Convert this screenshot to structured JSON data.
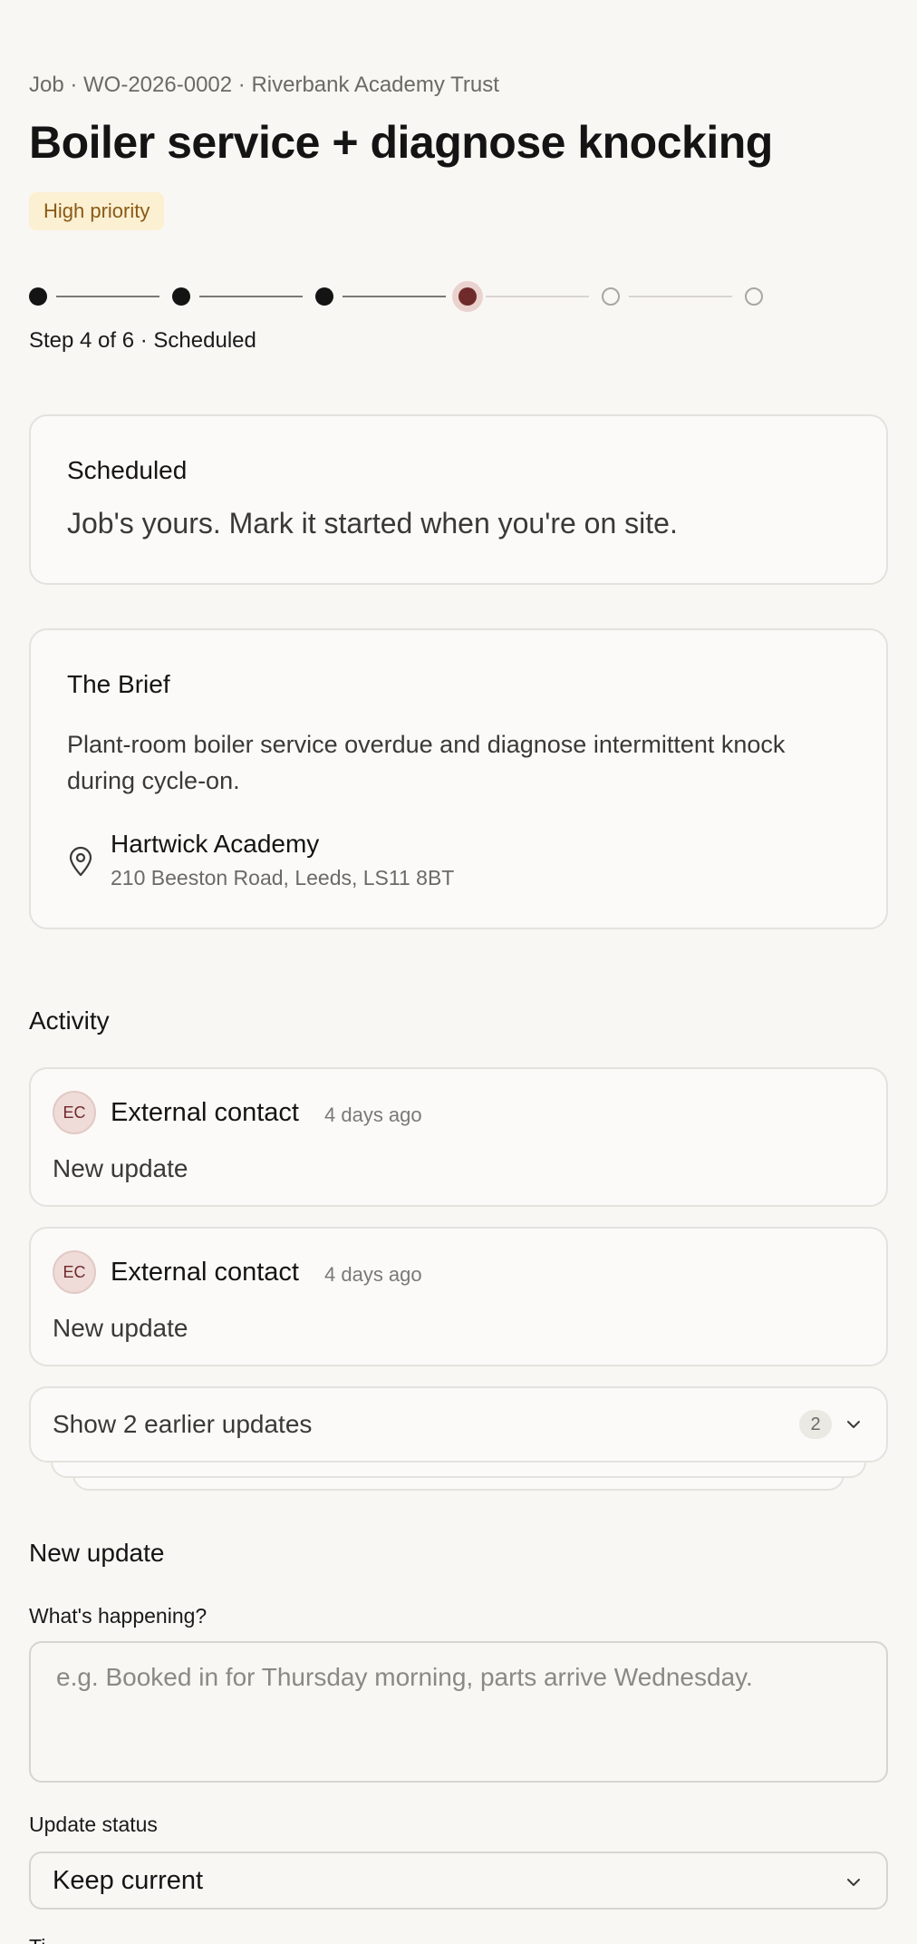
{
  "header": {
    "breadcrumb": "Job · WO-2026-0002 · Riverbank Academy Trust",
    "title": "Boiler service + diagnose knocking",
    "priority_badge": "High priority"
  },
  "progress": {
    "current_step": 4,
    "total_steps": 6,
    "label": "Step 4 of 6 · Scheduled"
  },
  "status_card": {
    "heading": "Scheduled",
    "message": "Job's yours. Mark it started when you're on site."
  },
  "brief": {
    "heading": "The Brief",
    "text": "Plant-room boiler service overdue and diagnose intermittent knock during cycle-on.",
    "location_name": "Hartwick Academy",
    "location_address": "210 Beeston Road, Leeds, LS11 8BT",
    "location_icon": "map-pin-icon"
  },
  "activity": {
    "heading": "Activity",
    "items": [
      {
        "initials": "EC",
        "author": "External contact",
        "time": "4 days ago",
        "body": "New update"
      },
      {
        "initials": "EC",
        "author": "External contact",
        "time": "4 days ago",
        "body": "New update"
      }
    ],
    "earlier_label": "Show 2 earlier updates",
    "earlier_count": "2"
  },
  "new_update": {
    "heading": "New update",
    "happening_label": "What's happening?",
    "happening_placeholder": "e.g. Booked in for Thursday morning, parts arrive Wednesday.",
    "happening_value": "",
    "status_label": "Update status",
    "status_value": "Keep current",
    "next_label": "Ti"
  },
  "colors": {
    "accent": "#6f2a2a",
    "badge_bg": "#fbf0d2",
    "badge_text": "#8a5a14",
    "background": "#f8f7f4"
  }
}
